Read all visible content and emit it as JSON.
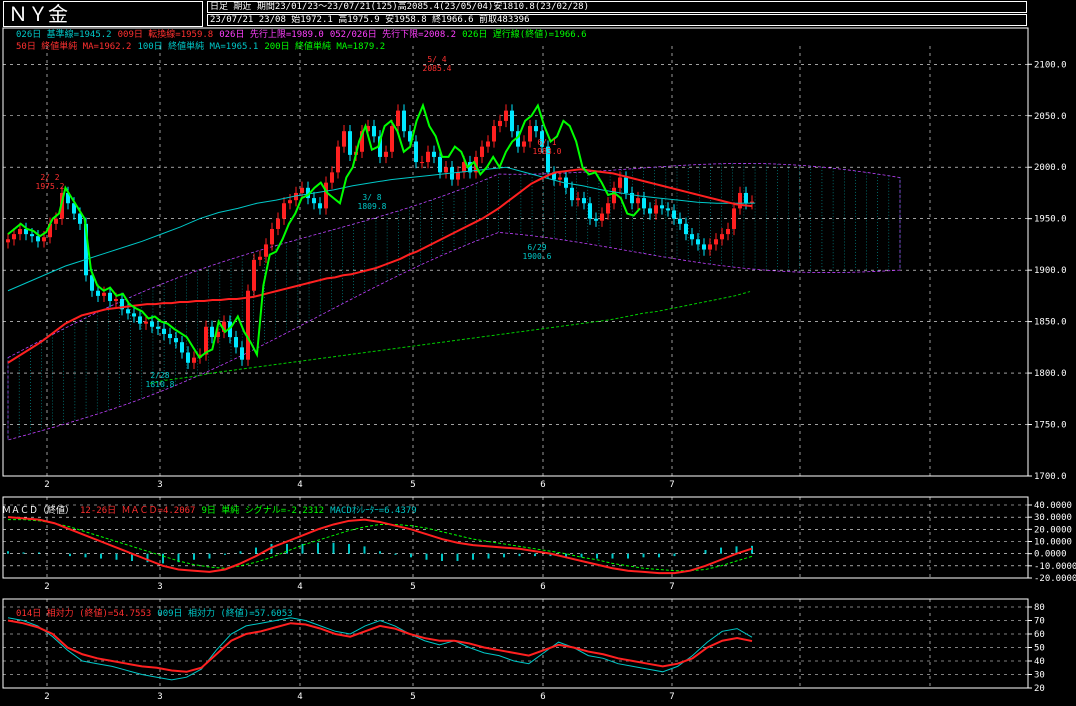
{
  "header": {
    "title": "ＮＹ金",
    "row1": "日足 期近 期間23/01/23～23/07/21(125)高2085.4(23/05/04)安1810.8(23/02/28)",
    "row2": "23/07/21 23/08 始1972.1 高1975.9 安1958.8 終1966.6 前取483396"
  },
  "legend": {
    "line1": [
      {
        "text": "026日 基準線=1945.2",
        "color": "#00c8c8"
      },
      {
        "text": "009日 転換線=1959.8",
        "color": "#ff3030"
      },
      {
        "text": "026日 先行上限=1989.0",
        "color": "#ff40ff"
      },
      {
        "text": "052/026日 先行下限=2008.2",
        "color": "#ff40ff"
      },
      {
        "text": "026日 遅行線(終値)=1966.6",
        "color": "#00ff00"
      }
    ],
    "line2": [
      {
        "text": "50日 終値単純 MA=1962.2",
        "color": "#ff3030"
      },
      {
        "text": "100日 終値単純 MA=1965.1",
        "color": "#00c8c8"
      },
      {
        "text": "200日 終値単純 MA=1879.2",
        "color": "#00ff00"
      }
    ],
    "macd": [
      {
        "text": "ＭＡＣＤ（終値）",
        "color": "#ffffff"
      },
      {
        "text": "12-26日 ＭＡＣＤ=4.2067",
        "color": "#ff3030"
      },
      {
        "text": "9日 単純 シグナル=-2.2312",
        "color": "#00ff00"
      },
      {
        "text": "MACDｵｼﾚｰﾀｰ=6.4379",
        "color": "#00c8c8"
      }
    ],
    "rsi": [
      {
        "text": "014日 相対力 (終値)=54.7553",
        "color": "#ff3030"
      },
      {
        "text": "009日 相対力 (終値)=57.6053",
        "color": "#00c8c8"
      }
    ]
  },
  "annotations": [
    {
      "date": "2/ 2",
      "value": "1975.2"
    },
    {
      "date": "2/28",
      "value": "1810.8"
    },
    {
      "date": "3/ 8",
      "value": "1809.8"
    },
    {
      "date": "5/ 4",
      "value": "2085.4"
    },
    {
      "date": "6/ 1",
      "value": "1983.0"
    },
    {
      "date": "6/29",
      "value": "1900.6"
    }
  ],
  "chart_data": [
    {
      "type": "candlestick",
      "ylim": [
        1700,
        2110
      ],
      "y_ticks": [
        1700,
        1750,
        1800,
        1850,
        1900,
        1950,
        2000,
        2050,
        2100
      ],
      "y_tick_labels": [
        "1700.0",
        "1750.0",
        "1800.0",
        "1850.0",
        "1900.0",
        "1950.0",
        "2000.0",
        "2050.0",
        "2100.0"
      ],
      "month_labels": [
        "2",
        "3",
        "4",
        "5",
        "6",
        "7"
      ],
      "colors": {
        "up": "#ff2020",
        "down": "#00e8ff",
        "ma50": "#ff2020",
        "ma100": "#00c8c8",
        "ma200": "#00cc00",
        "lagging": "#00ff00",
        "cloud": "#c040ff",
        "cloud_hatch": "#00c8c8"
      },
      "close": [
        1930,
        1935,
        1940,
        1935,
        1933,
        1928,
        1932,
        1945,
        1950,
        1975,
        1965,
        1955,
        1945,
        1895,
        1880,
        1875,
        1878,
        1870,
        1872,
        1862,
        1858,
        1855,
        1848,
        1850,
        1845,
        1843,
        1838,
        1834,
        1830,
        1820,
        1810,
        1815,
        1818,
        1845,
        1835,
        1840,
        1850,
        1835,
        1825,
        1813,
        1880,
        1910,
        1913,
        1925,
        1940,
        1950,
        1965,
        1968,
        1975,
        1980,
        1970,
        1965,
        1960,
        1985,
        1995,
        2020,
        2035,
        2012,
        2015,
        2035,
        2040,
        2030,
        2010,
        2015,
        2040,
        2055,
        2035,
        2025,
        2005,
        2005,
        2015,
        2010,
        1995,
        2000,
        1988,
        1995,
        2005,
        1995,
        2010,
        2020,
        2025,
        2040,
        2045,
        2055,
        2035,
        2020,
        2025,
        2040,
        2035,
        2020,
        1995,
        1988,
        1990,
        1980,
        1968,
        1970,
        1965,
        1950,
        1948,
        1955,
        1965,
        1980,
        1990,
        1975,
        1965,
        1970,
        1960,
        1955,
        1963,
        1960,
        1958,
        1950,
        1945,
        1935,
        1930,
        1925,
        1920,
        1925,
        1930,
        1935,
        1940,
        1960,
        1975,
        1965,
        1966.6
      ],
      "ma50": [
        1810,
        1815,
        1820,
        1825,
        1830,
        1836,
        1842,
        1848,
        1852,
        1856,
        1858,
        1860,
        1862,
        1863,
        1864,
        1865,
        1866,
        1867,
        1867,
        1868,
        1868,
        1869,
        1869,
        1870,
        1870,
        1871,
        1871,
        1872,
        1872,
        1873,
        1874,
        1876,
        1878,
        1880,
        1882,
        1884,
        1886,
        1888,
        1890,
        1892,
        1893,
        1895,
        1896,
        1898,
        1900,
        1902,
        1905,
        1908,
        1911,
        1915,
        1918,
        1922,
        1926,
        1930,
        1934,
        1938,
        1942,
        1946,
        1950,
        1955,
        1960,
        1966,
        1972,
        1978,
        1984,
        1988,
        1992,
        1995,
        1996,
        1997,
        1998,
        1997,
        1996,
        1995,
        1994,
        1992,
        1990,
        1988,
        1986,
        1984,
        1982,
        1980,
        1978,
        1976,
        1974,
        1972,
        1970,
        1968,
        1966,
        1964,
        1963,
        1962.2
      ],
      "ma100": [
        1880,
        1888,
        1896,
        1904,
        1910,
        1916,
        1922,
        1928,
        1935,
        1942,
        1950,
        1956,
        1960,
        1965,
        1968,
        1972,
        1975,
        1978,
        1982,
        1985,
        1988,
        1990,
        1992,
        1994,
        1996,
        1998,
        2000,
        1995,
        1990,
        1985,
        1982,
        1978,
        1975,
        1972,
        1970,
        1968,
        1966,
        1965,
        1965,
        1965.1
      ],
      "ma200": [
        1790,
        1793,
        1795,
        1797,
        1800,
        1802,
        1804,
        1806,
        1808,
        1810,
        1812,
        1814,
        1816,
        1818,
        1820,
        1822,
        1824,
        1826,
        1828,
        1830,
        1832,
        1834,
        1836,
        1838,
        1840,
        1842,
        1844,
        1846,
        1848,
        1850,
        1852,
        1855,
        1858,
        1860,
        1863,
        1866,
        1869,
        1872,
        1875,
        1879.2
      ]
    },
    {
      "type": "macd",
      "ylim": [
        -20,
        40
      ],
      "y_ticks": [
        -20,
        -10,
        0,
        10,
        20,
        30,
        40
      ],
      "y_tick_labels": [
        "-20.0000",
        "-10.0000",
        "0.0000",
        "10.0000",
        "20.0000",
        "30.0000",
        "40.0000"
      ],
      "macd": [
        30,
        29,
        28,
        25,
        20,
        15,
        10,
        5,
        0,
        -5,
        -10,
        -13,
        -14,
        -15,
        -13,
        -8,
        -2,
        5,
        10,
        15,
        20,
        24,
        27,
        28,
        26,
        23,
        20,
        16,
        12,
        9,
        7,
        6,
        5,
        4,
        2,
        0,
        -3,
        -6,
        -9,
        -12,
        -14,
        -15,
        -16,
        -16,
        -14,
        -10,
        -5,
        0,
        4.2067
      ],
      "signal": [
        28,
        28,
        27,
        25,
        22,
        18,
        14,
        10,
        6,
        2,
        -2,
        -6,
        -9,
        -11,
        -12,
        -10,
        -7,
        -3,
        2,
        7,
        11,
        15,
        19,
        22,
        24,
        24,
        23,
        21,
        18,
        15,
        12,
        10,
        8,
        6,
        4,
        2,
        0,
        -3,
        -5,
        -8,
        -10,
        -12,
        -13,
        -14,
        -14,
        -13,
        -10,
        -6,
        -2.2312
      ],
      "oscillator": [
        2,
        1,
        1,
        0,
        -2,
        -3,
        -4,
        -5,
        -6,
        -7,
        -8,
        -7,
        -5,
        -4,
        -1,
        2,
        5,
        8,
        8,
        8,
        9,
        9,
        8,
        6,
        2,
        -1,
        -3,
        -5,
        -6,
        -6,
        -5,
        -4,
        -3,
        -2,
        -2,
        -2,
        -3,
        -3,
        -4,
        -4,
        -4,
        -3,
        -3,
        -2,
        0,
        3,
        5,
        6,
        6.4379
      ]
    },
    {
      "type": "line",
      "ylim": [
        20,
        80
      ],
      "y_ticks": [
        20,
        30,
        40,
        50,
        60,
        70,
        80
      ],
      "y_tick_labels": [
        "20",
        "30",
        "40",
        "50",
        "60",
        "70",
        "80"
      ],
      "rsi14": [
        70,
        68,
        65,
        60,
        50,
        45,
        42,
        40,
        38,
        36,
        35,
        33,
        32,
        35,
        45,
        55,
        60,
        62,
        65,
        68,
        67,
        64,
        60,
        58,
        62,
        66,
        64,
        60,
        57,
        55,
        55,
        53,
        50,
        48,
        46,
        44,
        48,
        52,
        50,
        47,
        45,
        42,
        40,
        38,
        36,
        38,
        42,
        50,
        55,
        57,
        54.7553
      ],
      "rsi9": [
        72,
        70,
        66,
        58,
        48,
        40,
        38,
        36,
        33,
        30,
        28,
        26,
        28,
        34,
        48,
        60,
        66,
        68,
        70,
        72,
        70,
        66,
        62,
        60,
        66,
        70,
        66,
        60,
        55,
        52,
        55,
        50,
        46,
        44,
        40,
        38,
        46,
        54,
        50,
        44,
        42,
        38,
        36,
        34,
        32,
        36,
        44,
        54,
        62,
        64,
        57.6053
      ]
    }
  ]
}
